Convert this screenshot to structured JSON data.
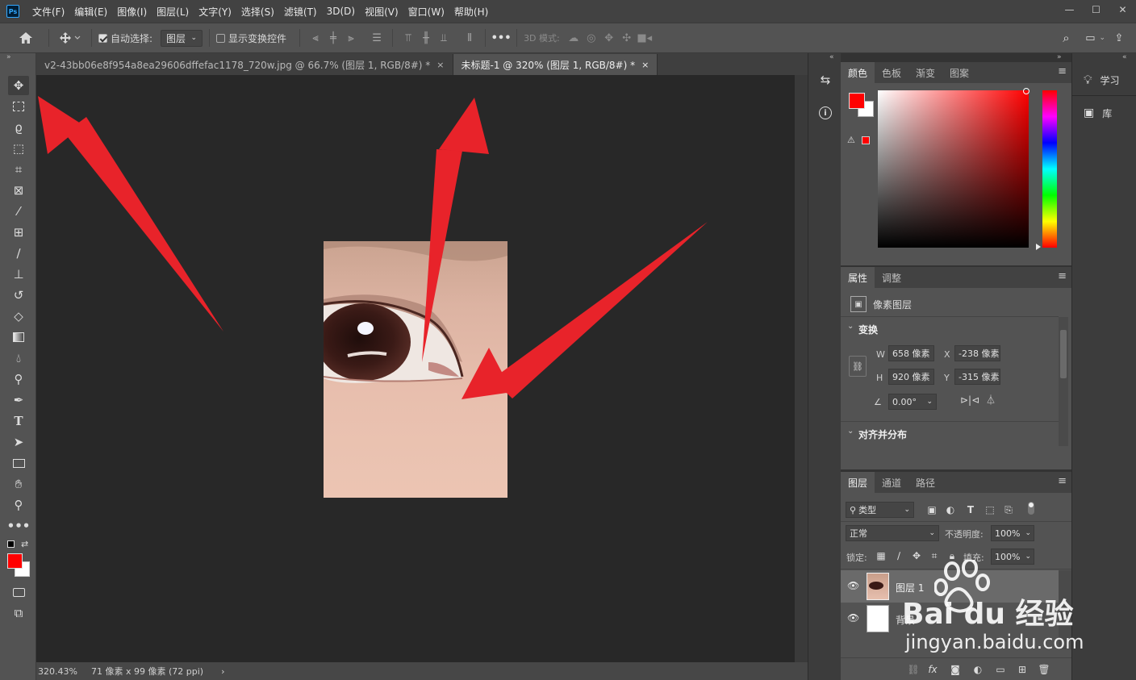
{
  "menubar": {
    "logo": "Ps",
    "items": [
      "文件(F)",
      "编辑(E)",
      "图像(I)",
      "图层(L)",
      "文字(Y)",
      "选择(S)",
      "滤镜(T)",
      "3D(D)",
      "视图(V)",
      "窗口(W)",
      "帮助(H)"
    ],
    "window_controls": [
      "—",
      "☐",
      "✕"
    ]
  },
  "options": {
    "auto_select_label": "自动选择:",
    "auto_select_checked": true,
    "auto_select_target": "图层",
    "show_transform_label": "显示变换控件",
    "show_transform_checked": false,
    "more": "•••",
    "mode_3d_label": "3D 模式:"
  },
  "documents": {
    "tabs": [
      {
        "title": "v2-43bb06e8f954a8ea29606dffefac1178_720w.jpg @ 66.7% (图层 1, RGB/8#) *",
        "active": false,
        "close": "×"
      },
      {
        "title": "未标题-1 @ 320% (图层 1, RGB/8#) *",
        "active": true,
        "close": "×"
      }
    ]
  },
  "status": {
    "zoom": "320.43%",
    "doc_info": "71 像素 x 99 像素 (72 ppi)",
    "arrow": "›"
  },
  "colors": {
    "foreground": "#ff0000",
    "background": "#ffffff",
    "annotation_arrow": "#e8232a",
    "panel_bg": "#535353",
    "canvas_bg": "#282828"
  },
  "color_panel": {
    "tabs": [
      "颜色",
      "色板",
      "渐变",
      "图案"
    ],
    "active_tab": "颜色"
  },
  "properties_panel": {
    "tabs": [
      "属性",
      "调整"
    ],
    "active_tab": "属性",
    "layer_type": "像素图层",
    "transform_title": "变换",
    "w_label": "W",
    "w_value": "658 像素",
    "h_label": "H",
    "h_value": "920 像素",
    "x_label": "X",
    "x_value": "-238 像素",
    "y_label": "Y",
    "y_value": "-315 像素",
    "angle_value": "0.00°",
    "align_title": "对齐并分布"
  },
  "layers_panel": {
    "tabs": [
      "图层",
      "通道",
      "路径"
    ],
    "active_tab": "图层",
    "filter_kind": "类型",
    "blend_mode": "正常",
    "opacity_label": "不透明度:",
    "opacity_value": "100%",
    "lock_label": "锁定:",
    "fill_label": "填充:",
    "fill_value": "100%",
    "layers": [
      {
        "name": "图层 1",
        "selected": true
      },
      {
        "name": "背景",
        "selected": false
      }
    ]
  },
  "right_dock": {
    "items": [
      {
        "label": "学习",
        "icon": "lightbulb-icon"
      },
      {
        "label": "库",
        "icon": "library-icon"
      }
    ]
  },
  "watermark": {
    "brand": "Bai du 经验",
    "url": "jingyan.baidu.com"
  }
}
